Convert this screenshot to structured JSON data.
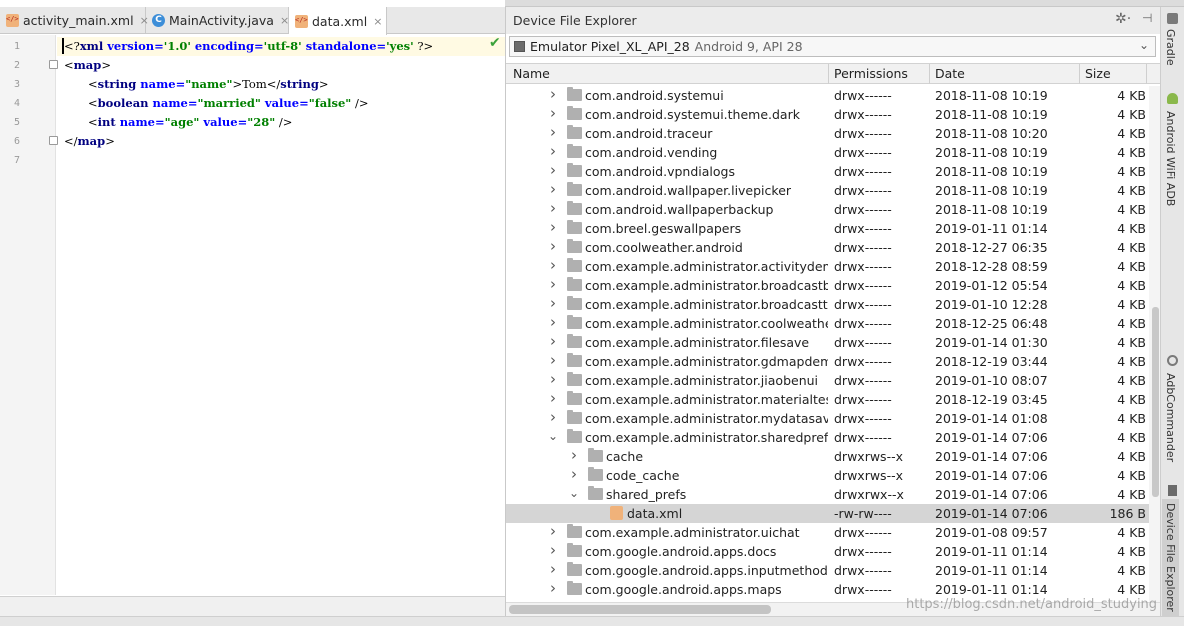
{
  "editor": {
    "tabs": [
      {
        "label": "activity_main.xml",
        "icon": "xml-file-icon",
        "active": false
      },
      {
        "label": "MainActivity.java",
        "icon": "java-class-icon",
        "icon_letter": "C",
        "active": false
      },
      {
        "label": "data.xml",
        "icon": "xml-file-icon",
        "active": true
      }
    ],
    "close_glyph": "×",
    "line_numbers": [
      "1",
      "2",
      "3",
      "4",
      "5",
      "6",
      "7"
    ],
    "code": {
      "l1": {
        "open": "<?",
        "kw": "xml",
        "a1": " version=",
        "v1": "'1.0'",
        "a2": " encoding=",
        "v2": "'utf-8'",
        "a3": " standalone=",
        "v3": "'yes'",
        "close": " ?>"
      },
      "l2": {
        "open": "<",
        "tag": "map",
        "close": ">"
      },
      "l3": {
        "open": "<",
        "tag": "string",
        "a1": " name=",
        "v1": "\"name\"",
        "mid": ">Tom</",
        "tag2": "string",
        "close": ">"
      },
      "l4": {
        "open": "<",
        "tag": "boolean",
        "a1": " name=",
        "v1": "\"married\"",
        "a2": " value=",
        "v2": "\"false\"",
        "close": " />"
      },
      "l5": {
        "open": "<",
        "tag": "int",
        "a1": " name=",
        "v1": "\"age\"",
        "a2": " value=",
        "v2": "\"28\"",
        "close": " />"
      },
      "l6": {
        "open": "</",
        "tag": "map",
        "close": ">"
      }
    },
    "inspection_icon": "check-icon",
    "inspection_glyph": "✔"
  },
  "explorer": {
    "title": "Device File Explorer",
    "gear_glyph": "✲·",
    "hide_glyph": "⊣",
    "device": {
      "name": "Emulator Pixel_XL_API_28",
      "api": "Android 9, API 28",
      "chevron": "⌄"
    },
    "columns": {
      "name": "Name",
      "permissions": "Permissions",
      "date": "Date",
      "size": "Size"
    },
    "rows": [
      {
        "name": "com.android.systemui",
        "perm": "drwx------",
        "date": "2018-11-08 10:19",
        "size": "4 KB",
        "depth": 0,
        "expander": "›",
        "type": "folder"
      },
      {
        "name": "com.android.systemui.theme.dark",
        "perm": "drwx------",
        "date": "2018-11-08 10:19",
        "size": "4 KB",
        "depth": 0,
        "expander": "›",
        "type": "folder"
      },
      {
        "name": "com.android.traceur",
        "perm": "drwx------",
        "date": "2018-11-08 10:20",
        "size": "4 KB",
        "depth": 0,
        "expander": "›",
        "type": "folder"
      },
      {
        "name": "com.android.vending",
        "perm": "drwx------",
        "date": "2018-11-08 10:19",
        "size": "4 KB",
        "depth": 0,
        "expander": "›",
        "type": "folder"
      },
      {
        "name": "com.android.vpndialogs",
        "perm": "drwx------",
        "date": "2018-11-08 10:19",
        "size": "4 KB",
        "depth": 0,
        "expander": "›",
        "type": "folder"
      },
      {
        "name": "com.android.wallpaper.livepicker",
        "perm": "drwx------",
        "date": "2018-11-08 10:19",
        "size": "4 KB",
        "depth": 0,
        "expander": "›",
        "type": "folder"
      },
      {
        "name": "com.android.wallpaperbackup",
        "perm": "drwx------",
        "date": "2018-11-08 10:19",
        "size": "4 KB",
        "depth": 0,
        "expander": "›",
        "type": "folder"
      },
      {
        "name": "com.breel.geswallpapers",
        "perm": "drwx------",
        "date": "2019-01-11 01:14",
        "size": "4 KB",
        "depth": 0,
        "expander": "›",
        "type": "folder"
      },
      {
        "name": "com.coolweather.android",
        "perm": "drwx------",
        "date": "2018-12-27 06:35",
        "size": "4 KB",
        "depth": 0,
        "expander": "›",
        "type": "folder"
      },
      {
        "name": "com.example.administrator.activitydemo",
        "perm": "drwx------",
        "date": "2018-12-28 08:59",
        "size": "4 KB",
        "depth": 0,
        "expander": "›",
        "type": "folder"
      },
      {
        "name": "com.example.administrator.broadcastbest",
        "perm": "drwx------",
        "date": "2019-01-12 05:54",
        "size": "4 KB",
        "depth": 0,
        "expander": "›",
        "type": "folder"
      },
      {
        "name": "com.example.administrator.broadcasttest",
        "perm": "drwx------",
        "date": "2019-01-10 12:28",
        "size": "4 KB",
        "depth": 0,
        "expander": "›",
        "type": "folder"
      },
      {
        "name": "com.example.administrator.coolweather",
        "perm": "drwx------",
        "date": "2018-12-25 06:48",
        "size": "4 KB",
        "depth": 0,
        "expander": "›",
        "type": "folder"
      },
      {
        "name": "com.example.administrator.filesave",
        "perm": "drwx------",
        "date": "2019-01-14 01:30",
        "size": "4 KB",
        "depth": 0,
        "expander": "›",
        "type": "folder"
      },
      {
        "name": "com.example.administrator.gdmapdemo",
        "perm": "drwx------",
        "date": "2018-12-19 03:44",
        "size": "4 KB",
        "depth": 0,
        "expander": "›",
        "type": "folder"
      },
      {
        "name": "com.example.administrator.jiaobenui",
        "perm": "drwx------",
        "date": "2019-01-10 08:07",
        "size": "4 KB",
        "depth": 0,
        "expander": "›",
        "type": "folder"
      },
      {
        "name": "com.example.administrator.materialtest",
        "perm": "drwx------",
        "date": "2018-12-19 03:45",
        "size": "4 KB",
        "depth": 0,
        "expander": "›",
        "type": "folder"
      },
      {
        "name": "com.example.administrator.mydatasave",
        "perm": "drwx------",
        "date": "2019-01-14 01:08",
        "size": "4 KB",
        "depth": 0,
        "expander": "›",
        "type": "folder"
      },
      {
        "name": "com.example.administrator.sharedpreferences",
        "perm": "drwx------",
        "date": "2019-01-14 07:06",
        "size": "4 KB",
        "depth": 0,
        "expander": "⌄",
        "type": "folder"
      },
      {
        "name": "cache",
        "perm": "drwxrws--x",
        "date": "2019-01-14 07:06",
        "size": "4 KB",
        "depth": 1,
        "expander": "›",
        "type": "folder"
      },
      {
        "name": "code_cache",
        "perm": "drwxrws--x",
        "date": "2019-01-14 07:06",
        "size": "4 KB",
        "depth": 1,
        "expander": "›",
        "type": "folder"
      },
      {
        "name": "shared_prefs",
        "perm": "drwxrwx--x",
        "date": "2019-01-14 07:06",
        "size": "4 KB",
        "depth": 1,
        "expander": "⌄",
        "type": "folder"
      },
      {
        "name": "data.xml",
        "perm": "-rw-rw----",
        "date": "2019-01-14 07:06",
        "size": "186 B",
        "depth": 2,
        "expander": "",
        "type": "xml-file",
        "selected": true
      },
      {
        "name": "com.example.administrator.uichat",
        "perm": "drwx------",
        "date": "2019-01-08 09:57",
        "size": "4 KB",
        "depth": 0,
        "expander": "›",
        "type": "folder"
      },
      {
        "name": "com.google.android.apps.docs",
        "perm": "drwx------",
        "date": "2019-01-11 01:14",
        "size": "4 KB",
        "depth": 0,
        "expander": "›",
        "type": "folder"
      },
      {
        "name": "com.google.android.apps.inputmethod.hindi",
        "perm": "drwx------",
        "date": "2019-01-11 01:14",
        "size": "4 KB",
        "depth": 0,
        "expander": "›",
        "type": "folder"
      },
      {
        "name": "com.google.android.apps.maps",
        "perm": "drwx------",
        "date": "2019-01-11 01:14",
        "size": "4 KB",
        "depth": 0,
        "expander": "›",
        "type": "folder"
      }
    ]
  },
  "side_tools": [
    {
      "label": "Gradle",
      "icon": "gradle-icon",
      "active": false
    },
    {
      "label": "Android WiFi ADB",
      "icon": "android-icon",
      "active": false
    },
    {
      "label": "AdbCommander",
      "icon": "gear-icon",
      "active": false
    },
    {
      "label": "Device File Explorer",
      "icon": "device-icon",
      "active": true
    }
  ],
  "watermark": "https://blog.csdn.net/android_studying",
  "colors": {
    "keyword": "#000080",
    "attribute": "#0000ff",
    "string": "#008000",
    "selection": "#d5d5d5",
    "caret_line": "#fffae3"
  }
}
